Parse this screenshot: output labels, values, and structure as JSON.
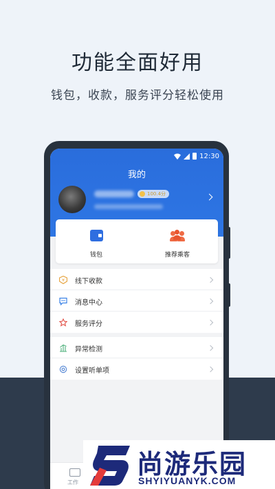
{
  "promo": {
    "headline": "功能全面好用",
    "subline": "钱包，收款，服务评分轻松使用"
  },
  "status_bar": {
    "time": "12:30"
  },
  "app": {
    "title": "我的",
    "profile": {
      "score": "100.4分"
    },
    "quick_actions": [
      {
        "label": "钱包",
        "icon": "wallet-icon"
      },
      {
        "label": "推荐乘客",
        "icon": "people-icon"
      }
    ],
    "menu_group_1": [
      {
        "label": "线下收款",
        "icon": "payment-icon"
      },
      {
        "label": "消息中心",
        "icon": "message-icon"
      },
      {
        "label": "服务评分",
        "icon": "star-icon"
      }
    ],
    "menu_group_2": [
      {
        "label": "异常检测",
        "icon": "detect-icon"
      },
      {
        "label": "设置听单项",
        "icon": "settings-icon"
      }
    ],
    "tabbar": {
      "label": "工作"
    }
  },
  "watermark": {
    "chinese": "尚游乐园",
    "english": "SHYIYUANYK.COM"
  },
  "colors": {
    "brand_blue": "#2e76e4",
    "accent_orange": "#ef6b45",
    "background": "#eef3f9",
    "dark": "#2e3b4c"
  }
}
